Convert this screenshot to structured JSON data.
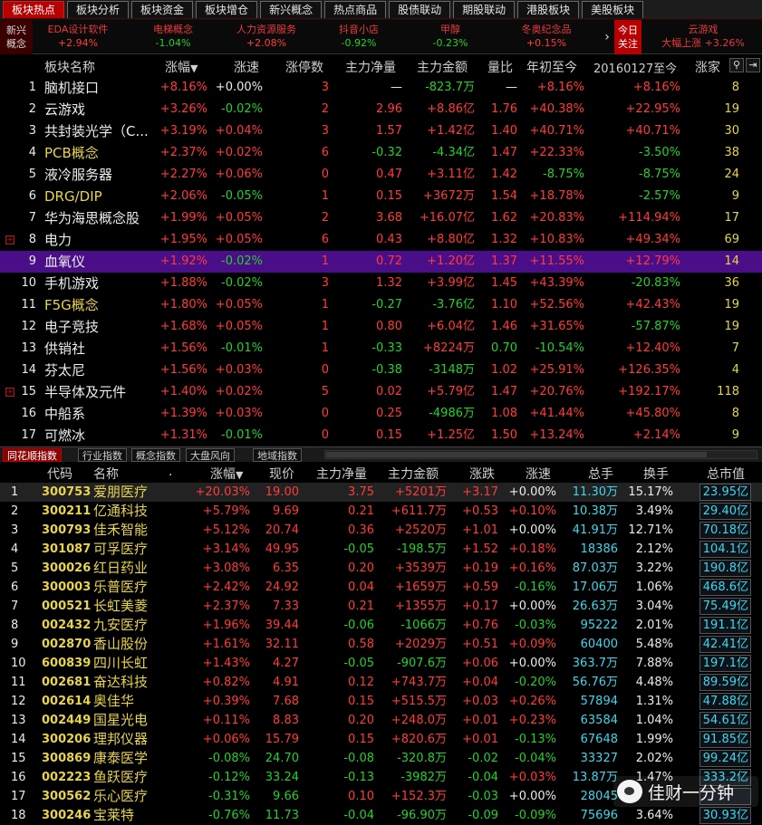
{
  "tabs": [
    "板块热点",
    "板块分析",
    "板块资金",
    "板块增仓",
    "新兴概念",
    "热点商品",
    "股债联动",
    "期股联动",
    "港股板块",
    "美股板块"
  ],
  "ticker": {
    "label_line1": "新兴",
    "label_line2": "概念",
    "items": [
      {
        "name": "EDA设计软件",
        "pct": "+2.94%",
        "color": "r"
      },
      {
        "name": "电梯概念",
        "pct": "-1.04%",
        "color": "g"
      },
      {
        "name": "人力资源服务",
        "pct": "+2.08%",
        "color": "r"
      },
      {
        "name": "抖音小店",
        "pct": "-0.92%",
        "color": "g"
      },
      {
        "name": "甲醇",
        "pct": "-0.23%",
        "color": "g"
      },
      {
        "name": "冬奥纪念品",
        "pct": "+0.15%",
        "color": "r"
      }
    ],
    "arrow": "›",
    "today_line1": "今日",
    "today_line2": "关注",
    "last_name": "云游戏",
    "last_sub": "大幅上涨 +3.26%"
  },
  "sector_table": {
    "headers": [
      "板块名称",
      "涨幅",
      "涨速",
      "涨停数",
      "主力净量",
      "主力金额",
      "量比",
      "年初至今",
      "20160127至今",
      "涨家"
    ],
    "sort_indicator": "▼",
    "icons": [
      "search-icon",
      "export-icon"
    ],
    "rows": [
      {
        "no": "1",
        "name": "脑机接口",
        "pct": "+8.16%",
        "speed": "+0.00%",
        "limit": "3",
        "netvol": "—",
        "amount": "-823.7万",
        "ratio": "—",
        "ytd": "+8.16%",
        "since": "+8.16%",
        "up": "8",
        "c": [
          "r",
          "w",
          "r",
          "w",
          "g",
          "w",
          "r",
          "r",
          "r"
        ],
        "plus": false,
        "sel": false
      },
      {
        "no": "2",
        "name": "云游戏",
        "pct": "+3.26%",
        "speed": "-0.02%",
        "limit": "2",
        "netvol": "2.96",
        "amount": "+8.86亿",
        "ratio": "1.76",
        "ytd": "+40.38%",
        "since": "+22.95%",
        "up": "19",
        "c": [
          "r",
          "g",
          "r",
          "r",
          "r",
          "r",
          "r",
          "r",
          "r"
        ],
        "plus": false,
        "sel": false
      },
      {
        "no": "3",
        "name": "共封装光学（C...",
        "pct": "+3.19%",
        "speed": "+0.04%",
        "limit": "3",
        "netvol": "1.57",
        "amount": "+1.42亿",
        "ratio": "1.40",
        "ytd": "+40.71%",
        "since": "+40.71%",
        "up": "30",
        "c": [
          "r",
          "r",
          "r",
          "r",
          "r",
          "r",
          "r",
          "r",
          "r"
        ],
        "plus": false,
        "sel": false
      },
      {
        "no": "4",
        "name": "PCB概念",
        "pct": "+2.37%",
        "speed": "+0.02%",
        "limit": "6",
        "netvol": "-0.32",
        "amount": "-4.34亿",
        "ratio": "1.47",
        "ytd": "+22.33%",
        "since": "-3.50%",
        "up": "38",
        "c": [
          "r",
          "r",
          "r",
          "g",
          "g",
          "r",
          "r",
          "g",
          "r"
        ],
        "plus": false,
        "sel": false
      },
      {
        "no": "5",
        "name": "液冷服务器",
        "pct": "+2.27%",
        "speed": "+0.06%",
        "limit": "0",
        "netvol": "0.47",
        "amount": "+3.11亿",
        "ratio": "1.42",
        "ytd": "-8.75%",
        "since": "-8.75%",
        "up": "24",
        "c": [
          "r",
          "r",
          "r",
          "r",
          "r",
          "r",
          "g",
          "g",
          "r"
        ],
        "plus": false,
        "sel": false
      },
      {
        "no": "6",
        "name": "DRG/DIP",
        "pct": "+2.06%",
        "speed": "-0.05%",
        "limit": "1",
        "netvol": "0.15",
        "amount": "+3672万",
        "ratio": "1.54",
        "ytd": "+18.78%",
        "since": "-2.57%",
        "up": "9",
        "c": [
          "r",
          "g",
          "r",
          "r",
          "r",
          "r",
          "r",
          "g",
          "r"
        ],
        "plus": false,
        "sel": false
      },
      {
        "no": "7",
        "name": "华为海思概念股",
        "pct": "+1.99%",
        "speed": "+0.05%",
        "limit": "2",
        "netvol": "3.68",
        "amount": "+16.07亿",
        "ratio": "1.62",
        "ytd": "+20.83%",
        "since": "+114.94%",
        "up": "17",
        "c": [
          "r",
          "r",
          "r",
          "r",
          "r",
          "r",
          "r",
          "r",
          "r"
        ],
        "plus": false,
        "sel": false
      },
      {
        "no": "8",
        "name": "电力",
        "pct": "+1.95%",
        "speed": "+0.05%",
        "limit": "6",
        "netvol": "0.43",
        "amount": "+8.80亿",
        "ratio": "1.32",
        "ytd": "+10.83%",
        "since": "+49.34%",
        "up": "69",
        "c": [
          "r",
          "r",
          "r",
          "r",
          "r",
          "r",
          "r",
          "r",
          "r"
        ],
        "plus": true,
        "sel": false
      },
      {
        "no": "9",
        "name": "血氧仪",
        "pct": "+1.92%",
        "speed": "-0.02%",
        "limit": "1",
        "netvol": "0.72",
        "amount": "+1.20亿",
        "ratio": "1.37",
        "ytd": "+11.55%",
        "since": "+12.79%",
        "up": "14",
        "c": [
          "r",
          "g",
          "r",
          "r",
          "r",
          "r",
          "r",
          "r",
          "r"
        ],
        "plus": false,
        "sel": true
      },
      {
        "no": "10",
        "name": "手机游戏",
        "pct": "+1.88%",
        "speed": "-0.02%",
        "limit": "3",
        "netvol": "1.32",
        "amount": "+3.99亿",
        "ratio": "1.45",
        "ytd": "+43.39%",
        "since": "-20.83%",
        "up": "36",
        "c": [
          "r",
          "g",
          "r",
          "r",
          "r",
          "r",
          "r",
          "g",
          "r"
        ],
        "plus": false,
        "sel": false
      },
      {
        "no": "11",
        "name": "F5G概念",
        "pct": "+1.80%",
        "speed": "+0.05%",
        "limit": "1",
        "netvol": "-0.27",
        "amount": "-3.76亿",
        "ratio": "1.10",
        "ytd": "+52.56%",
        "since": "+42.43%",
        "up": "19",
        "c": [
          "r",
          "r",
          "r",
          "g",
          "g",
          "r",
          "r",
          "r",
          "r"
        ],
        "plus": false,
        "sel": false
      },
      {
        "no": "12",
        "name": "电子竞技",
        "pct": "+1.68%",
        "speed": "+0.05%",
        "limit": "1",
        "netvol": "0.80",
        "amount": "+6.04亿",
        "ratio": "1.46",
        "ytd": "+31.65%",
        "since": "-57.87%",
        "up": "19",
        "c": [
          "r",
          "r",
          "r",
          "r",
          "r",
          "r",
          "r",
          "g",
          "r"
        ],
        "plus": false,
        "sel": false
      },
      {
        "no": "13",
        "name": "供销社",
        "pct": "+1.56%",
        "speed": "-0.01%",
        "limit": "1",
        "netvol": "-0.33",
        "amount": "+8224万",
        "ratio": "0.70",
        "ytd": "-10.54%",
        "since": "+12.40%",
        "up": "7",
        "c": [
          "r",
          "g",
          "r",
          "g",
          "r",
          "g",
          "g",
          "r",
          "r"
        ],
        "plus": false,
        "sel": false
      },
      {
        "no": "14",
        "name": "芬太尼",
        "pct": "+1.56%",
        "speed": "+0.03%",
        "limit": "0",
        "netvol": "-0.38",
        "amount": "-3148万",
        "ratio": "1.02",
        "ytd": "+25.91%",
        "since": "+126.35%",
        "up": "4",
        "c": [
          "r",
          "r",
          "r",
          "g",
          "g",
          "r",
          "r",
          "r",
          "r"
        ],
        "plus": false,
        "sel": false
      },
      {
        "no": "15",
        "name": "半导体及元件",
        "pct": "+1.40%",
        "speed": "+0.02%",
        "limit": "5",
        "netvol": "0.02",
        "amount": "+5.79亿",
        "ratio": "1.47",
        "ytd": "+20.76%",
        "since": "+192.17%",
        "up": "118",
        "c": [
          "r",
          "r",
          "r",
          "r",
          "r",
          "r",
          "r",
          "r",
          "r"
        ],
        "plus": true,
        "sel": false
      },
      {
        "no": "16",
        "name": "中船系",
        "pct": "+1.39%",
        "speed": "+0.03%",
        "limit": "0",
        "netvol": "0.25",
        "amount": "-4986万",
        "ratio": "1.08",
        "ytd": "+41.44%",
        "since": "+45.80%",
        "up": "8",
        "c": [
          "r",
          "r",
          "r",
          "r",
          "g",
          "r",
          "r",
          "r",
          "r"
        ],
        "plus": false,
        "sel": false
      },
      {
        "no": "17",
        "name": "可燃冰",
        "pct": "+1.31%",
        "speed": "-0.01%",
        "limit": "0",
        "netvol": "0.15",
        "amount": "+1.25亿",
        "ratio": "1.50",
        "ytd": "+13.24%",
        "since": "+2.14%",
        "up": "9",
        "c": [
          "r",
          "g",
          "r",
          "r",
          "r",
          "r",
          "r",
          "r",
          "r"
        ],
        "plus": false,
        "sel": false
      }
    ]
  },
  "subtabs": [
    "同花顺指数",
    "行业指数",
    "概念指数",
    "大盘风向",
    "地域指数"
  ],
  "stock_table": {
    "headers": [
      "代码",
      "名称",
      "涨幅",
      "现价",
      "主力净量",
      "主力金额",
      "涨跌",
      "涨速",
      "总手",
      "换手",
      "总市值"
    ],
    "sort_dot": ".",
    "sort_indicator": "▼",
    "rows": [
      {
        "no": "1",
        "code": "300753",
        "name": "爱朋医疗",
        "pct": "+20.03%",
        "price": "19.00",
        "netvol": "3.75",
        "amount": "+5201万",
        "chg": "+3.17",
        "speed": "+0.00%",
        "vol": "11.30万",
        "turn": "15.17%",
        "cap": "23.95亿",
        "c": [
          "r",
          "r",
          "r",
          "r",
          "r",
          "w"
        ],
        "sel": true
      },
      {
        "no": "2",
        "code": "300211",
        "name": "亿通科技",
        "pct": "+5.79%",
        "price": "9.69",
        "netvol": "0.21",
        "amount": "+611.7万",
        "chg": "+0.53",
        "speed": "+0.10%",
        "vol": "10.38万",
        "turn": "3.49%",
        "cap": "29.40亿",
        "c": [
          "r",
          "r",
          "r",
          "r",
          "r",
          "r"
        ],
        "sel": false
      },
      {
        "no": "3",
        "code": "300793",
        "name": "佳禾智能",
        "pct": "+5.12%",
        "price": "20.74",
        "netvol": "0.36",
        "amount": "+2520万",
        "chg": "+1.01",
        "speed": "+0.00%",
        "vol": "41.91万",
        "turn": "12.71%",
        "cap": "70.18亿",
        "c": [
          "r",
          "r",
          "r",
          "r",
          "r",
          "w"
        ],
        "sel": false
      },
      {
        "no": "4",
        "code": "301087",
        "name": "可孚医疗",
        "pct": "+3.14%",
        "price": "49.95",
        "netvol": "-0.05",
        "amount": "-198.5万",
        "chg": "+1.52",
        "speed": "+0.18%",
        "vol": "18386",
        "turn": "2.12%",
        "cap": "104.1亿",
        "c": [
          "r",
          "r",
          "g",
          "g",
          "r",
          "r"
        ],
        "sel": false
      },
      {
        "no": "5",
        "code": "300026",
        "name": "红日药业",
        "pct": "+3.08%",
        "price": "6.35",
        "netvol": "0.20",
        "amount": "+3539万",
        "chg": "+0.19",
        "speed": "+0.16%",
        "vol": "87.03万",
        "turn": "3.22%",
        "cap": "190.8亿",
        "c": [
          "r",
          "r",
          "r",
          "r",
          "r",
          "r"
        ],
        "sel": false
      },
      {
        "no": "6",
        "code": "300003",
        "name": "乐普医疗",
        "pct": "+2.42%",
        "price": "24.92",
        "netvol": "0.04",
        "amount": "+1659万",
        "chg": "+0.59",
        "speed": "-0.16%",
        "vol": "17.06万",
        "turn": "1.06%",
        "cap": "468.6亿",
        "c": [
          "r",
          "r",
          "r",
          "r",
          "r",
          "g"
        ],
        "sel": false
      },
      {
        "no": "7",
        "code": "000521",
        "name": "长虹美菱",
        "pct": "+2.37%",
        "price": "7.33",
        "netvol": "0.21",
        "amount": "+1355万",
        "chg": "+0.17",
        "speed": "+0.00%",
        "vol": "26.63万",
        "turn": "3.04%",
        "cap": "75.49亿",
        "c": [
          "r",
          "r",
          "r",
          "r",
          "r",
          "w"
        ],
        "sel": false
      },
      {
        "no": "8",
        "code": "002432",
        "name": "九安医疗",
        "pct": "+1.96%",
        "price": "39.44",
        "netvol": "-0.06",
        "amount": "-1066万",
        "chg": "+0.76",
        "speed": "-0.03%",
        "vol": "95222",
        "turn": "2.01%",
        "cap": "191.1亿",
        "c": [
          "r",
          "r",
          "g",
          "g",
          "r",
          "g"
        ],
        "sel": false
      },
      {
        "no": "9",
        "code": "002870",
        "name": "香山股份",
        "pct": "+1.61%",
        "price": "32.11",
        "netvol": "0.58",
        "amount": "+2029万",
        "chg": "+0.51",
        "speed": "+0.09%",
        "vol": "60400",
        "turn": "5.48%",
        "cap": "42.41亿",
        "c": [
          "r",
          "r",
          "r",
          "r",
          "r",
          "r"
        ],
        "sel": false
      },
      {
        "no": "10",
        "code": "600839",
        "name": "四川长虹",
        "pct": "+1.43%",
        "price": "4.27",
        "netvol": "-0.05",
        "amount": "-907.6万",
        "chg": "+0.06",
        "speed": "+0.00%",
        "vol": "363.7万",
        "turn": "7.88%",
        "cap": "197.1亿",
        "c": [
          "r",
          "r",
          "g",
          "g",
          "r",
          "w"
        ],
        "sel": false
      },
      {
        "no": "11",
        "code": "002681",
        "name": "奋达科技",
        "pct": "+0.82%",
        "price": "4.91",
        "netvol": "0.12",
        "amount": "+743.7万",
        "chg": "+0.04",
        "speed": "-0.20%",
        "vol": "56.76万",
        "turn": "4.48%",
        "cap": "89.59亿",
        "c": [
          "r",
          "r",
          "r",
          "r",
          "r",
          "g"
        ],
        "sel": false
      },
      {
        "no": "12",
        "code": "002614",
        "name": "奥佳华",
        "pct": "+0.39%",
        "price": "7.68",
        "netvol": "0.15",
        "amount": "+515.5万",
        "chg": "+0.03",
        "speed": "+0.26%",
        "vol": "57894",
        "turn": "1.31%",
        "cap": "47.88亿",
        "c": [
          "r",
          "r",
          "r",
          "r",
          "r",
          "r"
        ],
        "sel": false
      },
      {
        "no": "13",
        "code": "002449",
        "name": "国星光电",
        "pct": "+0.11%",
        "price": "8.83",
        "netvol": "0.20",
        "amount": "+248.0万",
        "chg": "+0.01",
        "speed": "+0.23%",
        "vol": "63584",
        "turn": "1.04%",
        "cap": "54.61亿",
        "c": [
          "r",
          "r",
          "r",
          "r",
          "r",
          "r"
        ],
        "sel": false
      },
      {
        "no": "14",
        "code": "300206",
        "name": "理邦仪器",
        "pct": "+0.06%",
        "price": "15.79",
        "netvol": "0.15",
        "amount": "+820.6万",
        "chg": "+0.01",
        "speed": "-0.13%",
        "vol": "67648",
        "turn": "1.99%",
        "cap": "91.85亿",
        "c": [
          "r",
          "r",
          "r",
          "r",
          "r",
          "g"
        ],
        "sel": false
      },
      {
        "no": "15",
        "code": "300869",
        "name": "康泰医学",
        "pct": "-0.08%",
        "price": "24.70",
        "netvol": "-0.08",
        "amount": "-320.8万",
        "chg": "-0.02",
        "speed": "-0.04%",
        "vol": "33327",
        "turn": "2.02%",
        "cap": "99.24亿",
        "c": [
          "g",
          "g",
          "g",
          "g",
          "g",
          "g"
        ],
        "sel": false
      },
      {
        "no": "16",
        "code": "002223",
        "name": "鱼跃医疗",
        "pct": "-0.12%",
        "price": "33.24",
        "netvol": "-0.13",
        "amount": "-3982万",
        "chg": "-0.04",
        "speed": "+0.03%",
        "vol": "13.87万",
        "turn": "1.47%",
        "cap": "333.2亿",
        "c": [
          "g",
          "g",
          "g",
          "g",
          "g",
          "r"
        ],
        "sel": false
      },
      {
        "no": "17",
        "code": "300562",
        "name": "乐心医疗",
        "pct": "-0.31%",
        "price": "9.66",
        "netvol": "0.10",
        "amount": "+152.3万",
        "chg": "-0.03",
        "speed": "+0.00%",
        "vol": "28045",
        "turn": "",
        "cap": "",
        "c": [
          "g",
          "g",
          "r",
          "r",
          "g",
          "w"
        ],
        "sel": false
      },
      {
        "no": "18",
        "code": "300246",
        "name": "宝莱特",
        "pct": "-0.76%",
        "price": "11.73",
        "netvol": "-0.04",
        "amount": "-96.90万",
        "chg": "-0.09",
        "speed": "-0.09%",
        "vol": "75696",
        "turn": "3.64%",
        "cap": "30.93亿",
        "c": [
          "g",
          "g",
          "g",
          "g",
          "g",
          "g"
        ],
        "sel": false
      }
    ]
  },
  "watermark": {
    "text": "佳财一分钟",
    "icon": "wechat-icon"
  }
}
